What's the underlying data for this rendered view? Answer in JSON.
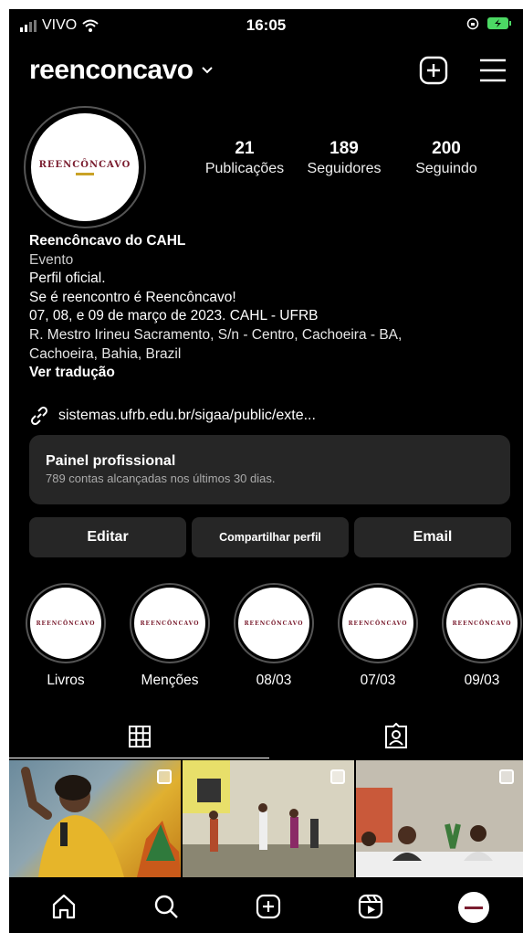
{
  "status_bar": {
    "carrier": "VIVO",
    "time": "16:05",
    "signal_icon": "signal-bars-icon",
    "wifi_icon": "wifi-icon",
    "battery_icon": "battery-charging-icon"
  },
  "header": {
    "username": "reenconcavo",
    "chevron_icon": "chevron-down-icon",
    "new_icon": "plus-square-icon",
    "menu_icon": "hamburger-menu-icon"
  },
  "profile": {
    "logo_text": "REENCÔNCAVO",
    "stats": [
      {
        "number": "21",
        "label": "Publicações"
      },
      {
        "number": "189",
        "label": "Seguidores"
      },
      {
        "number": "200",
        "label": "Seguindo"
      }
    ],
    "name": "Reencôncavo do CAHL",
    "category": "Evento",
    "bio_lines": [
      "Perfil oficial.",
      "Se é reencontro é Reencôncavo!",
      "07, 08, e 09 de março de 2023. CAHL - UFRB"
    ],
    "address_lines": [
      "R. Mestro Irineu Sacramento, S/n - Centro, Cachoeira - BA,",
      "Cachoeira, Bahia, Brazil"
    ],
    "translate": "Ver tradução",
    "link": "sistemas.ufrb.edu.br/sigaa/public/exte..."
  },
  "panel": {
    "title": "Painel profissional",
    "subtitle": "789 contas alcançadas nos últimos 30 dias."
  },
  "buttons": {
    "edit": "Editar",
    "share": "Compartilhar perfil",
    "email": "Email"
  },
  "highlights": [
    {
      "label": "Livros"
    },
    {
      "label": "Menções"
    },
    {
      "label": "08/03"
    },
    {
      "label": "07/03"
    },
    {
      "label": "09/03"
    }
  ],
  "tabs": [
    {
      "icon": "grid-icon",
      "active": true
    },
    {
      "icon": "tagged-icon",
      "active": false
    }
  ],
  "posts": [
    {
      "alt": "woman-with-microphone-photo",
      "color": "#d4a017"
    },
    {
      "alt": "presentation-stage-photo",
      "color": "#bfb79c"
    },
    {
      "alt": "panel-discussion-photo",
      "color": "#b9b4a8"
    }
  ],
  "bottom_nav": [
    "home-icon",
    "search-icon",
    "create-icon",
    "reels-icon",
    "profile-avatar-icon"
  ]
}
